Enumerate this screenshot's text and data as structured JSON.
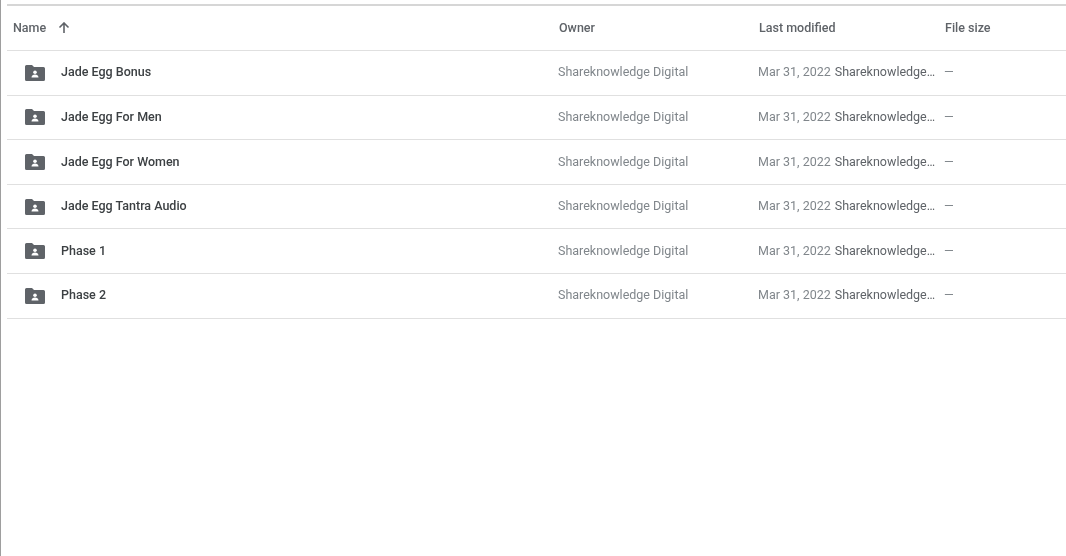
{
  "table": {
    "columns": [
      {
        "label": "Name",
        "sorted": true
      },
      {
        "label": "Owner",
        "sorted": false
      },
      {
        "label": "Last modified",
        "sorted": false
      },
      {
        "label": "File size",
        "sorted": false
      }
    ],
    "rows": [
      {
        "kind": "shared-folder",
        "name": "Jade Egg Bonus",
        "owner": "Shareknowledge Digital",
        "date": "Mar 31, 2022",
        "modified_by": "Shareknowledge…",
        "size": "—"
      },
      {
        "kind": "shared-folder",
        "name": "Jade Egg For Men",
        "owner": "Shareknowledge Digital",
        "date": "Mar 31, 2022",
        "modified_by": "Shareknowledge…",
        "size": "—"
      },
      {
        "kind": "shared-folder",
        "name": "Jade Egg For Women",
        "owner": "Shareknowledge Digital",
        "date": "Mar 31, 2022",
        "modified_by": "Shareknowledge…",
        "size": "—"
      },
      {
        "kind": "shared-folder",
        "name": "Jade Egg Tantra Audio",
        "owner": "Shareknowledge Digital",
        "date": "Mar 31, 2022",
        "modified_by": "Shareknowledge…",
        "size": "—"
      },
      {
        "kind": "shared-folder",
        "name": "Phase 1",
        "owner": "Shareknowledge Digital",
        "date": "Mar 31, 2022",
        "modified_by": "Shareknowledge…",
        "size": "—"
      },
      {
        "kind": "shared-folder",
        "name": "Phase 2",
        "owner": "Shareknowledge Digital",
        "date": "Mar 31, 2022",
        "modified_by": "Shareknowledge…",
        "size": "—"
      }
    ]
  }
}
